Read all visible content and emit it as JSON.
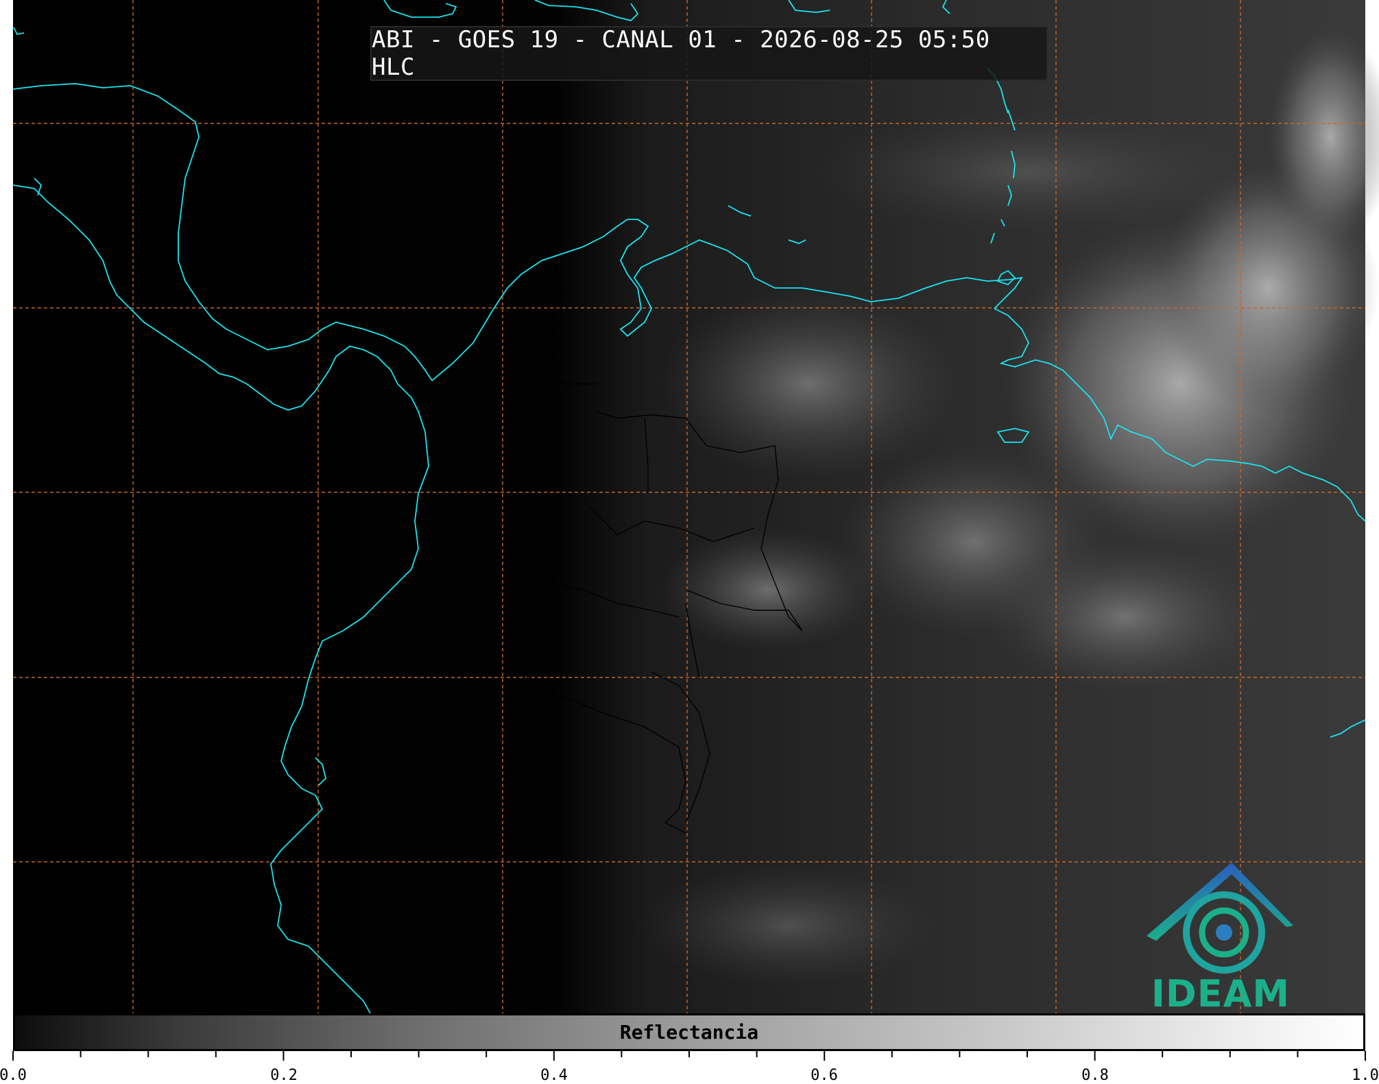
{
  "title": "ABI - GOES 19 - CANAL 01 - 2026-08-25 05:50 HLC",
  "colorbar": {
    "label": "Reflectancia",
    "ticks": [
      "0.0",
      "0.2",
      "0.4",
      "0.6",
      "0.8",
      "1.0"
    ]
  },
  "logo": {
    "text": "IDEAM"
  },
  "colors": {
    "coastline": "#19e5f0",
    "gridline": "#c8682a",
    "logo": "#1bb08a",
    "borders": "#000000"
  },
  "map": {
    "gridlines": "dashed",
    "coastlines": true,
    "country_borders": true
  }
}
